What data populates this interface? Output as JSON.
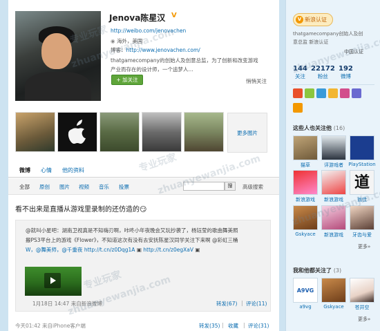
{
  "profile": {
    "name": "Jenova陈星汉",
    "verified_mark": "V",
    "weibo_url": "http://weibo.com/jenovachen",
    "location": "海外，美国",
    "blog_label": "博客：",
    "blog_url": "http://www.jenovachen.com/",
    "bio_line1": "thatgamecompany的创始人及创意总监，为了创新和改变游戏",
    "bio_line2": "产业而存在的设计师，一个追梦人...",
    "follow_button": "+ 加关注",
    "mutual_link": "悄悄关注"
  },
  "photos": {
    "more_label": "更多图片"
  },
  "tabs": [
    {
      "label": "微博"
    },
    {
      "label": "心情"
    },
    {
      "label": "他的资料"
    }
  ],
  "filters": [
    {
      "label": "全部"
    },
    {
      "label": "原创"
    },
    {
      "label": "图片"
    },
    {
      "label": "视频"
    },
    {
      "label": "音乐"
    },
    {
      "label": "投票"
    }
  ],
  "search": {
    "button": "搜",
    "advanced": "高级搜索"
  },
  "post": {
    "text": "看不出来是直播从游戏里录制的还仿造的",
    "emoji": "😏",
    "quote": {
      "line1": "@就叫小星吧：湖南卫视真是不知嗨刃啊，咔咚小年夜晚会又玩抄袭了，杨钰莹的歌曲舞美照",
      "line2": "搬PS3平台上的游戏《Flower》，不知道这次有没有去安抚陈星汉同学关注下来啊 @彩虹三桶",
      "line3a": "W，@舞美师，@千重夜 ",
      "link1": "http://t.cn/z0Dqg1A",
      "link2": "http://t.cn/z0egXaV",
      "date": "1月18日 14:47",
      "source": "来自新浪微博",
      "repost": "转发(67)",
      "comment": "评论(11)"
    },
    "time": "今天01:42",
    "source": "来自iPhone客户端",
    "repost": "转发(35)",
    "favorite": "收藏",
    "comment": "评论(31)"
  },
  "sidebar": {
    "badge": "新浪认证",
    "verify_text1": "thatgamecompany创始人及创",
    "verify_text2": "意总监 新浪认证",
    "region": "中国认证",
    "counts": [
      {
        "num": "144",
        "label": "关注"
      },
      {
        "num": "22172",
        "label": "粉丝"
      },
      {
        "num": "192",
        "label": "微博"
      }
    ],
    "also_follow_title": "这些人也关注他",
    "also_follow_count": "(16)",
    "also_follow": [
      {
        "name": "猫草"
      },
      {
        "name": "评游戏者"
      },
      {
        "name": "PlayStation"
      },
      {
        "name": "新浪游戏"
      },
      {
        "name": "新浪游戏"
      },
      {
        "name": "翁佳"
      },
      {
        "name": "Gskyace"
      },
      {
        "name": "新浪游戏"
      },
      {
        "name": "牙齿与爱"
      }
    ],
    "more": "更多»",
    "common_title": "我和他都关注了",
    "common_count": "(3)",
    "common": [
      {
        "name": "a9vg"
      },
      {
        "name": "Gskyace"
      },
      {
        "name": "苍井空"
      }
    ],
    "more2": "更多»"
  },
  "watermark": {
    "text1": "专业玩家",
    "text2": "zhuanyewanjia.com"
  }
}
